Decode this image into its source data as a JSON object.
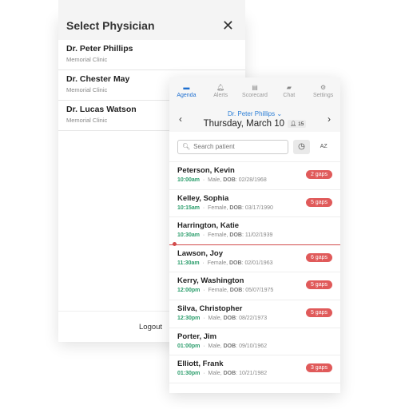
{
  "physician_modal": {
    "title": "Select Physician",
    "close_icon": "close-icon",
    "physicians": [
      {
        "name": "Dr. Peter Phillips",
        "clinic": "Memorial Clinic"
      },
      {
        "name": "Dr. Chester May",
        "clinic": "Memorial Clinic"
      },
      {
        "name": "Dr. Lucas Watson",
        "clinic": "Memorial Clinic"
      }
    ],
    "logout": "Logout"
  },
  "app": {
    "tabs": [
      {
        "label": "Agenda",
        "icon": "agenda-icon",
        "active": true
      },
      {
        "label": "Alerts",
        "icon": "bell-icon"
      },
      {
        "label": "Scorecard",
        "icon": "chart-icon"
      },
      {
        "label": "Chat",
        "icon": "chat-icon"
      },
      {
        "label": "Settings",
        "icon": "gear-icon"
      }
    ],
    "physician": "Dr. Peter Phillips",
    "date": "Thursday, March 10",
    "patient_count": "15",
    "search_placeholder": "Search patient",
    "sort_az": "AZ",
    "accent": "#1e6fd0",
    "patients": [
      {
        "name": "Peterson, Kevin",
        "time": "10:00am",
        "sex": "Male",
        "dob": "02/28/1968",
        "gaps": "2 gaps"
      },
      {
        "name": "Kelley, Sophia",
        "time": "10:15am",
        "sex": "Female",
        "dob": "03/17/1990",
        "gaps": "5 gaps"
      },
      {
        "name": "Harrington, Katie",
        "time": "10:30am",
        "sex": "Female",
        "dob": "11/02/1939",
        "gaps": ""
      },
      {
        "name": "Lawson, Joy",
        "time": "11:30am",
        "sex": "Female",
        "dob": "02/01/1963",
        "gaps": "6 gaps"
      },
      {
        "name": "Kerry, Washington",
        "time": "12:00pm",
        "sex": "Female",
        "dob": "05/07/1975",
        "gaps": "5 gaps"
      },
      {
        "name": "Silva, Christopher",
        "time": "12:30pm",
        "sex": "Male",
        "dob": "08/22/1973",
        "gaps": "5 gaps"
      },
      {
        "name": "Porter, Jim",
        "time": "01:00pm",
        "sex": "Male",
        "dob": "09/10/1962",
        "gaps": ""
      },
      {
        "name": "Elliott, Frank",
        "time": "01:30pm",
        "sex": "Male",
        "dob": "10/21/1982",
        "gaps": "3 gaps"
      }
    ],
    "dob_label": "DOB"
  }
}
